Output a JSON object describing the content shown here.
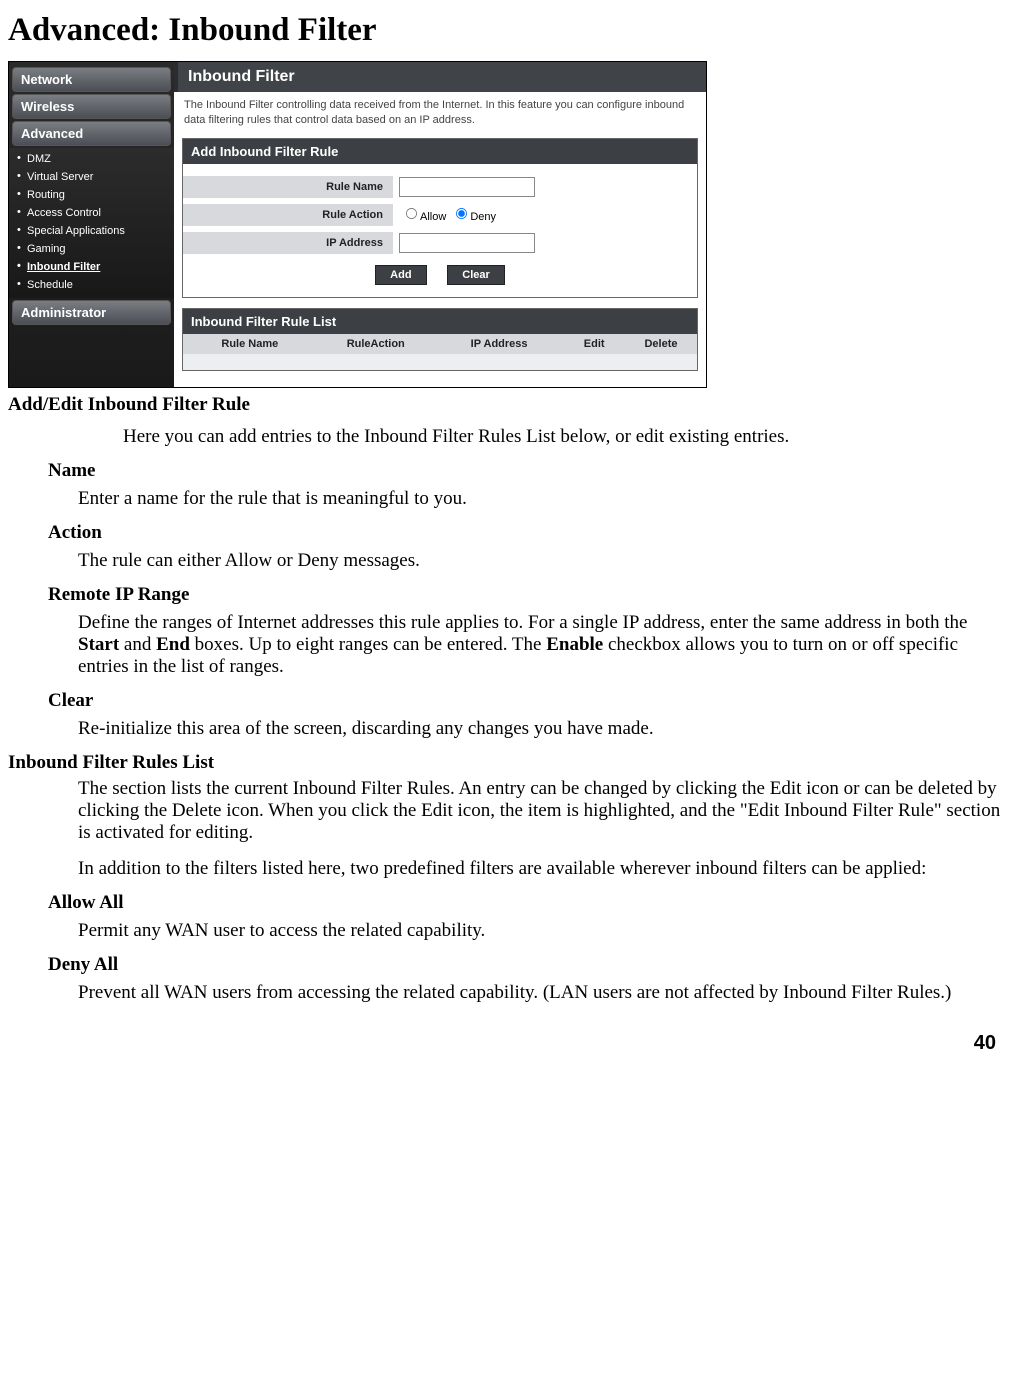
{
  "page": {
    "title": "Advanced: Inbound Filter",
    "number": "40"
  },
  "screenshot": {
    "sidebar": {
      "tabs": [
        "Network",
        "Wireless",
        "Advanced",
        "Administrator"
      ],
      "advanced_items": [
        "DMZ",
        "Virtual Server",
        "Routing",
        "Access Control",
        "Special Applications",
        "Gaming",
        "Inbound Filter",
        "Schedule"
      ]
    },
    "header": "Inbound Filter",
    "desc": "The Inbound Filter controlling data received from the Internet. In this feature you can configure inbound data filtering rules that control data based on an IP address.",
    "form_panel_title": "Add Inbound Filter Rule",
    "form": {
      "rule_name_label": "Rule Name",
      "rule_action_label": "Rule Action",
      "allow_label": "Allow",
      "deny_label": "Deny",
      "ip_label": "IP Address",
      "add_btn": "Add",
      "clear_btn": "Clear"
    },
    "list_panel_title": "Inbound Filter Rule List",
    "columns": {
      "c1": "Rule Name",
      "c2": "RuleAction",
      "c3": "IP Address",
      "c4": "Edit",
      "c5": "Delete"
    }
  },
  "doc": {
    "addedit_h": "Add/Edit Inbound Filter Rule",
    "addedit_intro": "Here you can add entries to the Inbound Filter Rules List below, or edit existing entries.",
    "name_h": "Name",
    "name_p": "Enter a name for the rule that is meaningful to you.",
    "action_h": "Action",
    "action_p": "The rule can either Allow or Deny messages.",
    "remote_h": "Remote IP Range",
    "remote_p_1": "Define the ranges of Internet addresses this rule applies to. For a single IP address, enter the same address in both the ",
    "remote_b1": "Start",
    "remote_mid1": " and ",
    "remote_b2": "End",
    "remote_mid2": " boxes. Up to eight ranges can be entered. The ",
    "remote_b3": "Enable",
    "remote_end": " checkbox allows you to turn on or off specific entries in the list of ranges.",
    "clear_h": "Clear",
    "clear_p": "Re-initialize this area of the screen, discarding any changes you have made.",
    "list_h": "Inbound Filter Rules List",
    "list_p1": "The section lists the current Inbound Filter Rules. An entry can be changed by clicking the Edit icon or can be deleted by clicking the Delete icon. When you click the Edit icon, the item is highlighted, and the \"Edit Inbound Filter Rule\" section is activated for editing.",
    "list_p2": "In addition to the filters listed here, two predefined filters are available wherever inbound filters can be applied:",
    "allowall_h": "Allow All",
    "allowall_p": "Permit any WAN user to access the related capability.",
    "denyall_h": "Deny All",
    "denyall_p": "Prevent all WAN users from accessing the related capability. (LAN users are not affected by Inbound Filter Rules.)"
  }
}
